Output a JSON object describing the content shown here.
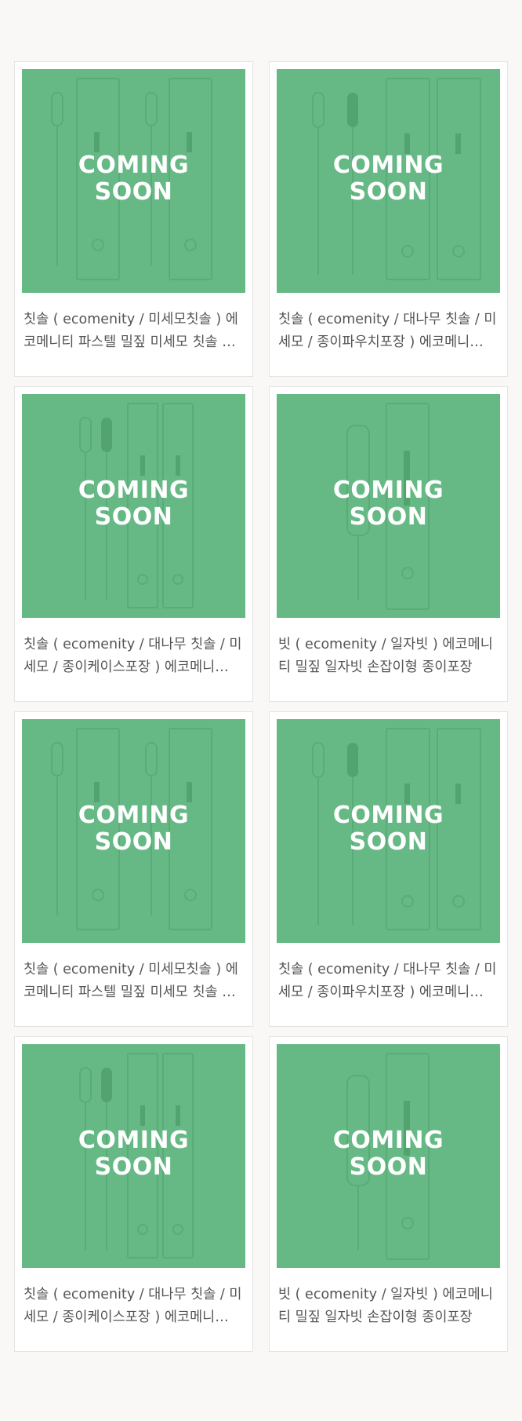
{
  "badge": {
    "line1": "COMING",
    "line2": "SOON"
  },
  "colors": {
    "page_bg": "#f9f8f7",
    "thumbnail_bg": "#66b985",
    "title_text": "#555555"
  },
  "products": [
    {
      "title": "칫솔 ( ecomenity / 미세모칫솔 ) 에코메니티 파스텔 밀짚 미세모 칫솔 …",
      "image": "toothbrush-pastel-image"
    },
    {
      "title": "칫솔 ( ecomenity / 대나무 칫솔 / 미세모 / 종이파우치포장 ) 에코메니…",
      "image": "toothbrush-pouch-image"
    },
    {
      "title": "칫솔 ( ecomenity / 대나무 칫솔 / 미세모 / 종이케이스포장 ) 에코메니…",
      "image": "toothbrush-case-image"
    },
    {
      "title": "빗 ( ecomenity / 일자빗 ) 에코메니티 밀짚 일자빗 손잡이형 종이포장",
      "image": "comb-image"
    },
    {
      "title": "칫솔 ( ecomenity / 미세모칫솔 ) 에코메니티 파스텔 밀짚 미세모 칫솔 …",
      "image": "toothbrush-pastel-image"
    },
    {
      "title": "칫솔 ( ecomenity / 대나무 칫솔 / 미세모 / 종이파우치포장 ) 에코메니…",
      "image": "toothbrush-pouch-image"
    },
    {
      "title": "칫솔 ( ecomenity / 대나무 칫솔 / 미세모 / 종이케이스포장 ) 에코메니…",
      "image": "toothbrush-case-image"
    },
    {
      "title": "빗 ( ecomenity / 일자빗 ) 에코메니티 밀짚 일자빗 손잡이형 종이포장",
      "image": "comb-image"
    }
  ]
}
